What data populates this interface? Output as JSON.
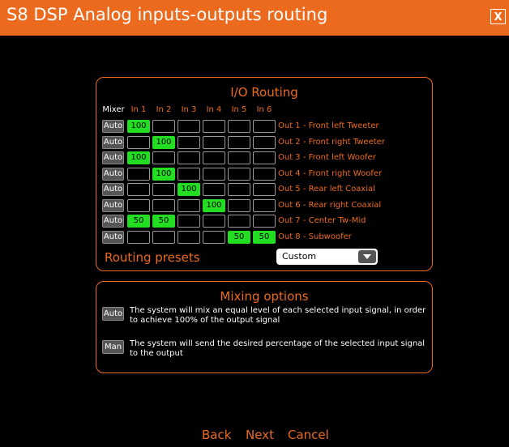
{
  "window": {
    "title": "S8 DSP Analog inputs-outputs routing",
    "close_label": "X"
  },
  "io_routing": {
    "title": "I/O Routing",
    "mixer_header": "Mixer",
    "input_headers": [
      "In 1",
      "In 2",
      "In 3",
      "In 4",
      "In 5",
      "In 6"
    ],
    "rows": [
      {
        "mixer": "Auto",
        "output": "Out 1 - Front left Tweeter",
        "cells": [
          "100",
          "",
          "",
          "",
          "",
          ""
        ]
      },
      {
        "mixer": "Auto",
        "output": "Out 2 - Front right Tweeter",
        "cells": [
          "",
          "100",
          "",
          "",
          "",
          ""
        ]
      },
      {
        "mixer": "Auto",
        "output": "Out 3 - Front left Woofer",
        "cells": [
          "100",
          "",
          "",
          "",
          "",
          ""
        ]
      },
      {
        "mixer": "Auto",
        "output": "Out 4 - Front right Woofer",
        "cells": [
          "",
          "100",
          "",
          "",
          "",
          ""
        ]
      },
      {
        "mixer": "Auto",
        "output": "Out 5 - Rear left Coaxial",
        "cells": [
          "",
          "",
          "100",
          "",
          "",
          ""
        ]
      },
      {
        "mixer": "Auto",
        "output": "Out 6 - Rear right Coaxial",
        "cells": [
          "",
          "",
          "",
          "100",
          "",
          ""
        ]
      },
      {
        "mixer": "Auto",
        "output": "Out 7 - Center Tw-Mid",
        "cells": [
          "50",
          "50",
          "",
          "",
          "",
          ""
        ]
      },
      {
        "mixer": "Auto",
        "output": "Out 8 - Subwoofer",
        "cells": [
          "",
          "",
          "",
          "",
          "50",
          "50"
        ]
      }
    ],
    "presets_label": "Routing presets",
    "presets_value": "Custom"
  },
  "mixing_options": {
    "title": "Mixing options",
    "auto_label": "Auto",
    "auto_desc": "The system will mix an equal level of each selected input signal, in order to achieve 100% of the output signal",
    "man_label": "Man",
    "man_desc": "The system will send the desired percentage of the selected input signal to the output"
  },
  "nav": {
    "back": "Back",
    "next": "Next",
    "cancel": "Cancel"
  },
  "colors": {
    "accent": "#ec6a1e",
    "active_cell": "#22dd22",
    "background": "#000000"
  }
}
